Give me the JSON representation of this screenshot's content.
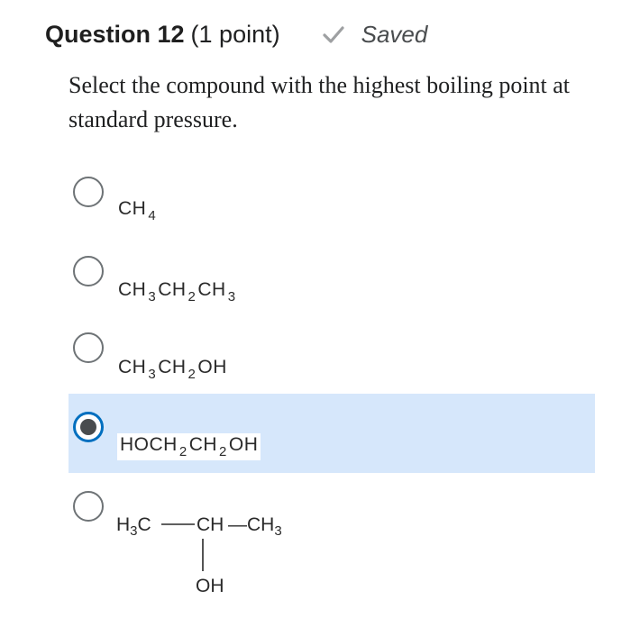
{
  "question": {
    "number_label": "Question 12",
    "points_label": "(1 point)",
    "saved_label": "Saved",
    "prompt": "Select the compound with the highest boiling point at standard pressure."
  },
  "options": [
    {
      "label": "CH4",
      "selected": false
    },
    {
      "label": "CH3CH2CH3",
      "selected": false
    },
    {
      "label": "CH3CH2OH",
      "selected": false
    },
    {
      "label": "HOCH2CH2OH",
      "selected": true
    },
    {
      "label": "H3C—CH—CH3 | OH",
      "selected": false
    }
  ],
  "formulas": {
    "opt1": {
      "a": "CH",
      "s1": "4"
    },
    "opt2": {
      "a": "CH",
      "s1": "3",
      "b": "CH",
      "s2": "2",
      "c": "CH",
      "s3": "3"
    },
    "opt3": {
      "a": "CH",
      "s1": "3",
      "b": "CH",
      "s2": "2",
      "c": "OH"
    },
    "opt4": {
      "a": "HOCH",
      "s1": "2",
      "b": "CH",
      "s2": "2",
      "c": "OH"
    },
    "opt5": {
      "left": "H",
      "left_sub": "3",
      "left_c": "C",
      "center": "CH",
      "right": "—CH",
      "right_sub": "3",
      "below": "OH"
    }
  },
  "colors": {
    "selected_bg": "#d6e7fb",
    "radio_checked_ring": "#006fbf",
    "radio_border": "#6e7376"
  },
  "icons": {
    "saved": "checkmark-icon"
  }
}
